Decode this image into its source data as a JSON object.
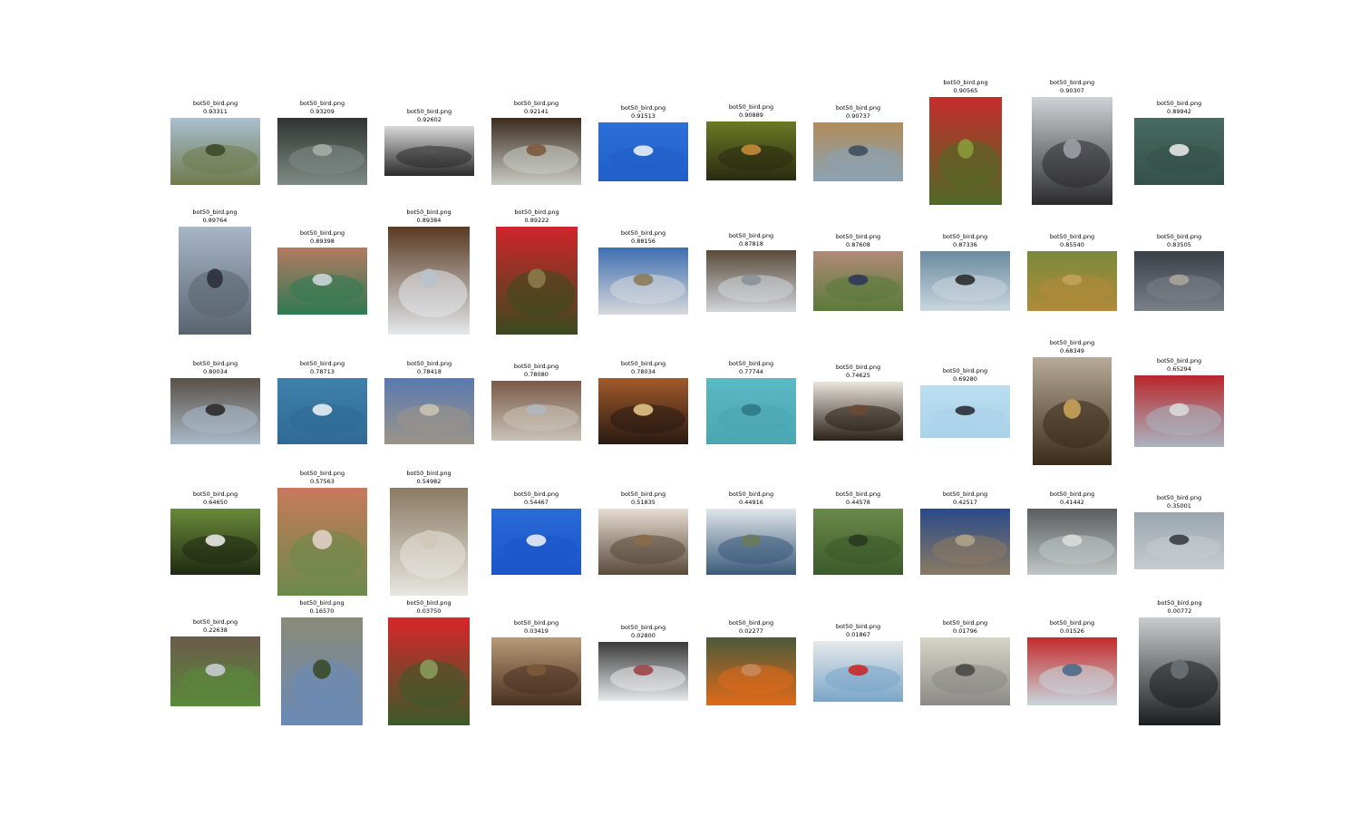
{
  "gallery": {
    "images": [
      {
        "filename": "bot50_bird.png",
        "score": "0.93311",
        "palette": [
          "#6f7a4c",
          "#a9bfd0",
          "#3e4a2a"
        ]
      },
      {
        "filename": "bot50_bird.png",
        "score": "0.93209",
        "palette": [
          "#7f8b86",
          "#2f3431",
          "#a4aca7"
        ]
      },
      {
        "filename": "bot50_bird.png",
        "score": "0.92602",
        "palette": [
          "#2a2a2a",
          "#d8d8d8",
          "#555555"
        ]
      },
      {
        "filename": "bot50_bird.png",
        "score": "0.92141",
        "palette": [
          "#c9ccc6",
          "#3b2b1e",
          "#7a5a3c"
        ]
      },
      {
        "filename": "bot50_bird.png",
        "score": "0.91513",
        "palette": [
          "#1f5fc7",
          "#2d6fd8",
          "#e8eef7"
        ]
      },
      {
        "filename": "bot50_bird.png",
        "score": "0.90889",
        "palette": [
          "#2a2a10",
          "#6a7a25",
          "#c48a3a"
        ]
      },
      {
        "filename": "bot50_bird.png",
        "score": "0.90737",
        "palette": [
          "#8aa3b5",
          "#b28c5a",
          "#3f4f5e"
        ]
      },
      {
        "filename": "bot50_bird.png",
        "score": "0.90565",
        "palette": [
          "#4f6a25",
          "#c62c2c",
          "#8a9a3a"
        ]
      },
      {
        "filename": "bot50_bird.png",
        "score": "0.90307",
        "palette": [
          "#2a2a2e",
          "#cfd2d6",
          "#9aa0a8"
        ]
      },
      {
        "filename": "bot50_bird.png",
        "score": "0.89942",
        "palette": [
          "#34504a",
          "#486a60",
          "#e6e6e6"
        ]
      },
      {
        "filename": "bot50_bird.png",
        "score": "0.89764",
        "palette": [
          "#5a6470",
          "#a7b6c8",
          "#2b3038"
        ]
      },
      {
        "filename": "bot50_bird.png",
        "score": "0.89398",
        "palette": [
          "#2f7a52",
          "#b47a62",
          "#c9d6d8"
        ]
      },
      {
        "filename": "bot50_bird.png",
        "score": "0.89384",
        "palette": [
          "#e4e8ec",
          "#5a3a22",
          "#b9c2ca"
        ]
      },
      {
        "filename": "bot50_bird.png",
        "score": "0.89222",
        "palette": [
          "#3a4a1e",
          "#d0242a",
          "#8a7a4a"
        ]
      },
      {
        "filename": "bot50_bird.png",
        "score": "0.88156",
        "palette": [
          "#d6d8dc",
          "#3f6fb0",
          "#8a7a5a"
        ]
      },
      {
        "filename": "bot50_bird.png",
        "score": "0.87818",
        "palette": [
          "#cfd6da",
          "#5a4a3a",
          "#8a9098"
        ]
      },
      {
        "filename": "bot50_bird.png",
        "score": "0.87608",
        "palette": [
          "#5a7a3a",
          "#b08a78",
          "#2f3a5a"
        ]
      },
      {
        "filename": "bot50_bird.png",
        "score": "0.87336",
        "palette": [
          "#c9d6de",
          "#6a8aa0",
          "#2b2b2b"
        ]
      },
      {
        "filename": "bot50_bird.png",
        "score": "0.85540",
        "palette": [
          "#b08a3a",
          "#7a8a3a",
          "#c2a25a"
        ]
      },
      {
        "filename": "bot50_bird.png",
        "score": "0.83505",
        "palette": [
          "#7a8088",
          "#3a4046",
          "#a8a49a"
        ]
      },
      {
        "filename": "bot50_bird.png",
        "score": "0.80034",
        "palette": [
          "#a9bac8",
          "#5a5048",
          "#2a2a2a"
        ]
      },
      {
        "filename": "bot50_bird.png",
        "score": "0.78713",
        "palette": [
          "#2f6a95",
          "#3f80ab",
          "#e8eef2"
        ]
      },
      {
        "filename": "bot50_bird.png",
        "score": "0.78418",
        "palette": [
          "#9a9488",
          "#5a7ab0",
          "#c8c2b2"
        ]
      },
      {
        "filename": "bot50_bird.png",
        "score": "0.78080",
        "palette": [
          "#c9c2b6",
          "#7a5a48",
          "#b0b8c0"
        ]
      },
      {
        "filename": "bot50_bird.png",
        "score": "0.78034",
        "palette": [
          "#2a1a12",
          "#a05a2a",
          "#e0c48a"
        ]
      },
      {
        "filename": "bot50_bird.png",
        "score": "0.77744",
        "palette": [
          "#4aa6b0",
          "#5cbac4",
          "#2f7a85"
        ]
      },
      {
        "filename": "bot50_bird.png",
        "score": "0.74625",
        "palette": [
          "#2a2018",
          "#e8e4dc",
          "#6a4a30"
        ]
      },
      {
        "filename": "bot50_bird.png",
        "score": "0.69280",
        "palette": [
          "#a9d2ea",
          "#bcdef0",
          "#2a3038"
        ]
      },
      {
        "filename": "bot50_bird.png",
        "score": "0.68349",
        "palette": [
          "#3a2a1a",
          "#b8aa98",
          "#c9a25a"
        ]
      },
      {
        "filename": "bot50_bird.png",
        "score": "0.65294",
        "palette": [
          "#aab4c0",
          "#b8262a",
          "#d8d8d8"
        ]
      },
      {
        "filename": "bot50_bird.png",
        "score": "0.64650",
        "palette": [
          "#1f2a12",
          "#6a8a3a",
          "#e8e8e8"
        ]
      },
      {
        "filename": "bot50_bird.png",
        "score": "0.57563",
        "palette": [
          "#6a8a4a",
          "#c87a5a",
          "#e0d0c8"
        ]
      },
      {
        "filename": "bot50_bird.png",
        "score": "0.54982",
        "palette": [
          "#e8e6e0",
          "#8a7a62",
          "#cfc8b8"
        ]
      },
      {
        "filename": "bot50_bird.png",
        "score": "0.54467",
        "palette": [
          "#1a55c9",
          "#2a6ad8",
          "#e8eef8"
        ]
      },
      {
        "filename": "bot50_bird.png",
        "score": "0.51835",
        "palette": [
          "#5a4a3a",
          "#e6dcd0",
          "#8a6a4a"
        ]
      },
      {
        "filename": "bot50_bird.png",
        "score": "0.44916",
        "palette": [
          "#3a5a7a",
          "#e0e6ea",
          "#6a7a5a"
        ]
      },
      {
        "filename": "bot50_bird.png",
        "score": "0.44578",
        "palette": [
          "#3a5a2a",
          "#6a8a4a",
          "#2a3a1e"
        ]
      },
      {
        "filename": "bot50_bird.png",
        "score": "0.42517",
        "palette": [
          "#8a7a62",
          "#2a4a8a",
          "#b0a288"
        ]
      },
      {
        "filename": "bot50_bird.png",
        "score": "0.41442",
        "palette": [
          "#c0c6c6",
          "#5a5e60",
          "#d8dcda"
        ]
      },
      {
        "filename": "bot50_bird.png",
        "score": "0.35001",
        "palette": [
          "#c6ccd0",
          "#9aa6ae",
          "#3a3e42"
        ]
      },
      {
        "filename": "bot50_bird.png",
        "score": "0.22638",
        "palette": [
          "#5a8a3a",
          "#6a5a4a",
          "#c8ccd0"
        ]
      },
      {
        "filename": "bot50_bird.png",
        "score": "0.16570",
        "palette": [
          "#6a8ab8",
          "#8a8a78",
          "#3a4a2a"
        ]
      },
      {
        "filename": "bot50_bird.png",
        "score": "0.03750",
        "palette": [
          "#3a5a2a",
          "#d8262a",
          "#8a9a5a"
        ]
      },
      {
        "filename": "bot50_bird.png",
        "score": "0.03419",
        "palette": [
          "#4a3020",
          "#b89a78",
          "#7a5a3a"
        ]
      },
      {
        "filename": "bot50_bird.png",
        "score": "0.02800",
        "palette": [
          "#e6e8ea",
          "#3a3a3a",
          "#a0424a"
        ]
      },
      {
        "filename": "bot50_bird.png",
        "score": "0.02277",
        "palette": [
          "#e06a1a",
          "#4a5a3a",
          "#c88a5a"
        ]
      },
      {
        "filename": "bot50_bird.png",
        "score": "0.01867",
        "palette": [
          "#7aa6c8",
          "#e6e8ea",
          "#c62a2a"
        ]
      },
      {
        "filename": "bot50_bird.png",
        "score": "0.01796",
        "palette": [
          "#8a8a86",
          "#d8d4c8",
          "#4a4a46"
        ]
      },
      {
        "filename": "bot50_bird.png",
        "score": "0.01526",
        "palette": [
          "#c8d6dc",
          "#c62a2a",
          "#4a6a8a"
        ]
      },
      {
        "filename": "bot50_bird.png",
        "score": "0.00772",
        "palette": [
          "#1a1e20",
          "#c8ccce",
          "#6a7074"
        ]
      }
    ]
  }
}
